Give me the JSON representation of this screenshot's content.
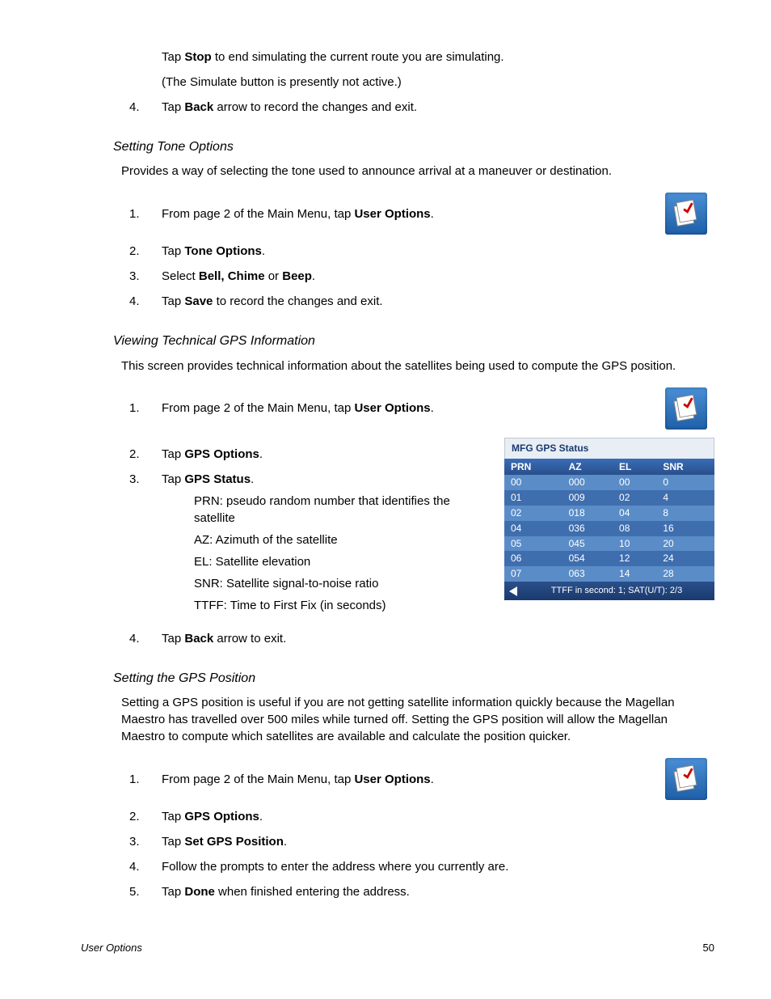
{
  "intro": {
    "stop_pre": "Tap  ",
    "stop_bold": "Stop",
    "stop_post": " to end simulating the current route you are simulating.",
    "sim_note": "(The Simulate button is presently not active.)",
    "step4_num": "4.",
    "step4_pre": "Tap ",
    "step4_bold": "Back",
    "step4_post": " arrow to record the changes and exit."
  },
  "tone": {
    "heading": "Setting Tone Options",
    "para": "Provides a way of selecting the tone used to announce arrival at a maneuver or destination.",
    "s1_num": "1.",
    "s1_pre": "From page 2 of the Main Menu, tap ",
    "s1_bold": "User Options",
    "s1_post": ".",
    "s2_num": "2.",
    "s2_pre": "Tap ",
    "s2_bold": "Tone Options",
    "s2_post": ".",
    "s3_num": "3.",
    "s3_pre": "Select ",
    "s3_bold": "Bell, Chime",
    "s3_mid": " or ",
    "s3_bold2": "Beep",
    "s3_post": ".",
    "s4_num": "4.",
    "s4_pre": "Tap ",
    "s4_bold": "Save",
    "s4_post": " to record the changes and exit."
  },
  "gps_view": {
    "heading": "Viewing Technical GPS Information",
    "para": "This screen provides technical information about the satellites being used to compute the GPS position.",
    "s1_num": "1.",
    "s1_pre": "From page 2 of the Main Menu, tap ",
    "s1_bold": "User Options",
    "s1_post": ".",
    "s2_num": "2.",
    "s2_pre": "Tap ",
    "s2_bold": "GPS Options",
    "s2_post": ".",
    "s3_num": "3.",
    "s3_pre": "Tap ",
    "s3_bold": "GPS Status",
    "s3_post": ".",
    "def_prn": "PRN: pseudo random number that identifies the satellite",
    "def_az": "AZ:  Azimuth of the satellite",
    "def_el": "EL:  Satellite elevation",
    "def_snr": "SNR: Satellite signal-to-noise ratio",
    "def_ttff": "TTFF: Time to First Fix (in seconds)",
    "s4_num": "4.",
    "s4_pre": "Tap ",
    "s4_bold": "Back",
    "s4_post": " arrow to exit."
  },
  "gps_status_widget": {
    "title": "MFG GPS Status",
    "cols": {
      "c1": "PRN",
      "c2": "AZ",
      "c3": "EL",
      "c4": "SNR"
    },
    "rows": [
      {
        "prn": "00",
        "az": "000",
        "el": "00",
        "snr": "0"
      },
      {
        "prn": "01",
        "az": "009",
        "el": "02",
        "snr": "4"
      },
      {
        "prn": "02",
        "az": "018",
        "el": "04",
        "snr": "8"
      },
      {
        "prn": "04",
        "az": "036",
        "el": "08",
        "snr": "16"
      },
      {
        "prn": "05",
        "az": "045",
        "el": "10",
        "snr": "20"
      },
      {
        "prn": "06",
        "az": "054",
        "el": "12",
        "snr": "24"
      },
      {
        "prn": "07",
        "az": "063",
        "el": "14",
        "snr": "28"
      }
    ],
    "footer": "TTFF in second: 1; SAT(U/T): 2/3"
  },
  "gps_set": {
    "heading": "Setting the GPS Position",
    "para": "Setting a GPS position is useful if you are not getting satellite information quickly because the Magellan Maestro has travelled over 500 miles while turned off.  Setting the GPS position will allow the Magellan Maestro to compute which satellites are available and calculate the position quicker.",
    "s1_num": "1.",
    "s1_pre": "From page 2 of the Main Menu, tap ",
    "s1_bold": "User Options",
    "s1_post": ".",
    "s2_num": "2.",
    "s2_pre": "Tap ",
    "s2_bold": "GPS Options",
    "s2_post": ".",
    "s3_num": "3.",
    "s3_pre": "Tap ",
    "s3_bold": "Set GPS Position",
    "s3_post": ".",
    "s4_num": "4.",
    "s4_text": "Follow the prompts to enter the address where you currently are.",
    "s5_num": "5.",
    "s5_pre": "Tap ",
    "s5_bold": "Done",
    "s5_post": " when finished entering the address."
  },
  "footer": {
    "left": "User Options",
    "right": "50"
  }
}
